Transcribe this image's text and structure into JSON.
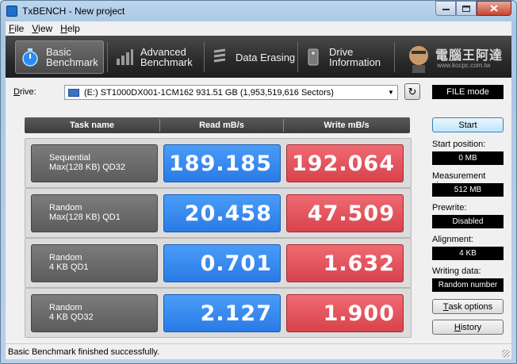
{
  "window": {
    "title": "TxBENCH - New project"
  },
  "menu": [
    {
      "label": "File",
      "underline": "F",
      "rest": "ile"
    },
    {
      "label": "View",
      "underline": "V",
      "rest": "iew"
    },
    {
      "label": "Help",
      "underline": "H",
      "rest": "elp"
    }
  ],
  "tabs": [
    {
      "line1": "Basic",
      "line2": "Benchmark",
      "icon": "stopwatch-icon",
      "active": true
    },
    {
      "line1": "Advanced",
      "line2": "Benchmark",
      "icon": "bar-chart-icon",
      "active": false
    },
    {
      "line1": "Data Erasing",
      "line2": "",
      "icon": "eraser-icon",
      "active": false
    },
    {
      "line1": "Drive",
      "line2": "Information",
      "icon": "drive-info-icon",
      "active": false
    }
  ],
  "logo": {
    "text": "電腦王阿達",
    "sub": "www.kocpc.com.tw"
  },
  "drive": {
    "label": "Drive:",
    "selected": "(E:) ST1000DX001-1CM162  931.51 GB (1,953,519,616 Sectors)",
    "mode": "FILE mode"
  },
  "table": {
    "headers": {
      "task": "Task name",
      "read": "Read mB/s",
      "write": "Write mB/s"
    },
    "rows": [
      {
        "line1": "Sequential",
        "line2": "Max(128 KB) QD32",
        "read": "189.185",
        "write": "192.064"
      },
      {
        "line1": "Random",
        "line2": "Max(128 KB) QD1",
        "read": "20.458",
        "write": "47.509"
      },
      {
        "line1": "Random",
        "line2": "4 KB QD1",
        "read": "0.701",
        "write": "1.632"
      },
      {
        "line1": "Random",
        "line2": "4 KB QD32",
        "read": "2.127",
        "write": "1.900"
      }
    ]
  },
  "side": {
    "start_button": "Start",
    "start_position_label": "Start position:",
    "start_position_value": "0 MB",
    "measurement_size_label": "Measurement size:",
    "measurement_size_value": "512 MB",
    "prewrite_label": "Prewrite:",
    "prewrite_value": "Disabled",
    "alignment_label": "Alignment:",
    "alignment_value": "4 KB",
    "writing_data_label": "Writing data:",
    "writing_data_value": "Random number",
    "task_options_button": "Task options",
    "task_options_underline": "T",
    "task_options_rest": "ask options",
    "history_button": "History",
    "history_underline": "H",
    "history_rest": "istory"
  },
  "status": {
    "text": "Basic Benchmark finished successfully."
  },
  "colors": {
    "read": "#2a7ae6",
    "write": "#d8424c",
    "toolbar": "#2a2a2a"
  }
}
